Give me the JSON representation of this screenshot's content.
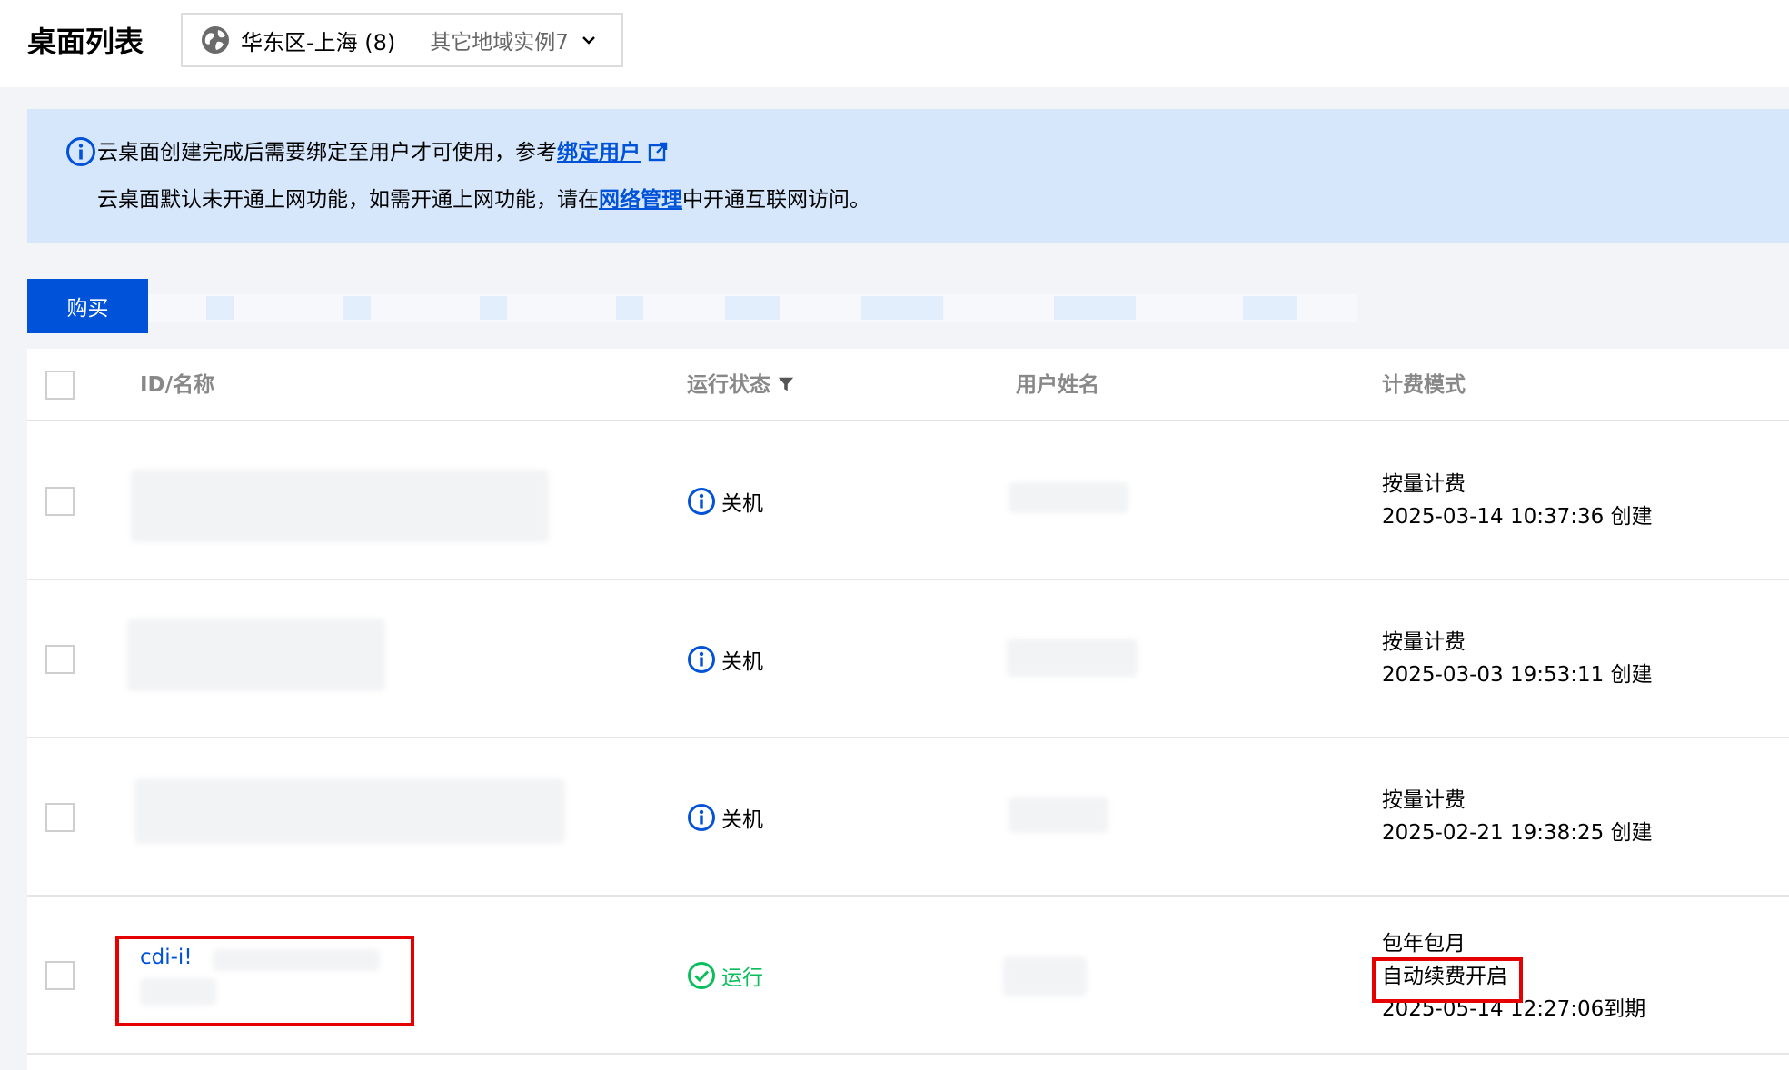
{
  "header": {
    "title": "桌面列表",
    "region": "华东区-上海 (8)",
    "other_regions": "其它地域实例7"
  },
  "notice": {
    "line1_text": "云桌面创建完成后需要绑定至用户才可使用，参考",
    "line1_link": "绑定用户",
    "line2_prefix": "云桌面默认未开通上网功能，如需开通上网功能，请在",
    "line2_link": "网络管理",
    "line2_suffix": "中开通互联网访问。"
  },
  "toolbar": {
    "buy_label": "购买"
  },
  "table": {
    "columns": [
      "ID/名称",
      "运行状态",
      "用户姓名",
      "计费模式"
    ],
    "rows": [
      {
        "status": "关机",
        "status_type": "off",
        "billing": [
          "按量计费",
          "2025-03-14 10:37:36 创建"
        ]
      },
      {
        "status": "关机",
        "status_type": "off",
        "billing": [
          "按量计费",
          "2025-03-03 19:53:11 创建"
        ]
      },
      {
        "status": "关机",
        "status_type": "off",
        "billing": [
          "按量计费",
          "2025-02-21 19:38:25 创建"
        ]
      },
      {
        "id": "cdi-i!",
        "status": "运行",
        "status_type": "on",
        "billing": [
          "包年包月",
          "自动续费开启",
          "2025-05-14 12:27:06到期"
        ]
      }
    ]
  },
  "colors": {
    "primary": "#0052d9",
    "success": "#0abf5b",
    "highlight": "#e60000",
    "notice_bg": "#d6e7fc"
  },
  "icons": {
    "region": "globe-icon",
    "notice": "info-icon",
    "filter": "filter-icon",
    "status_off": "info-circle-icon",
    "status_on": "check-circle-icon"
  }
}
